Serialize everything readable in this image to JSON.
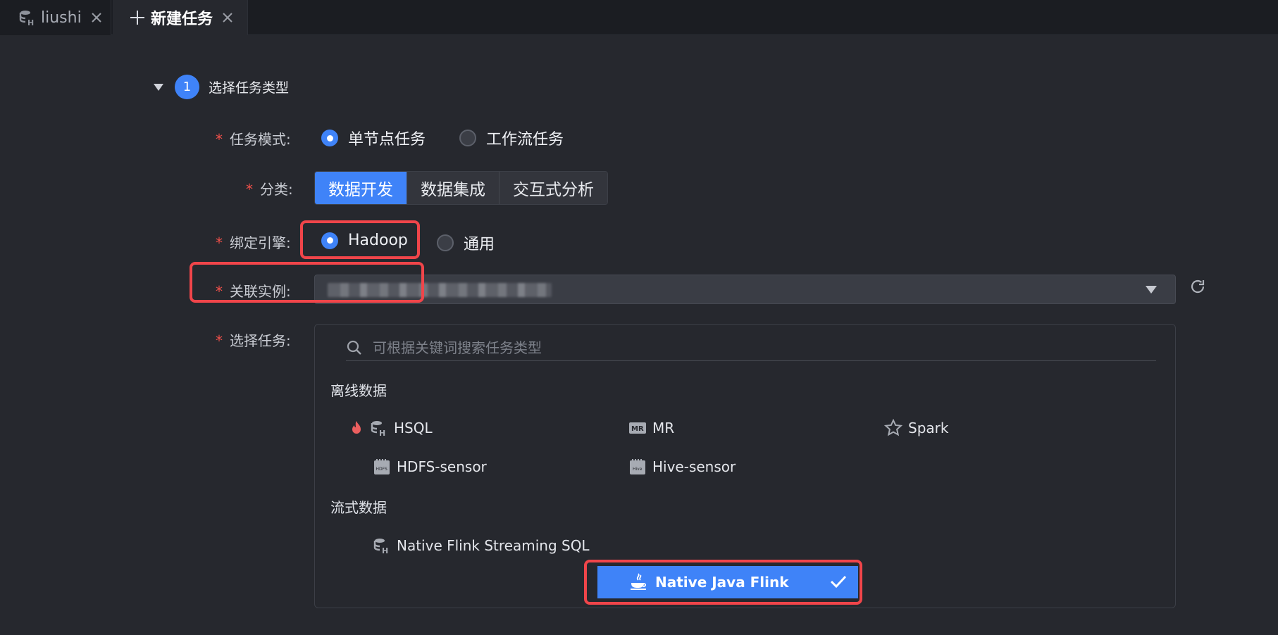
{
  "tabs": [
    {
      "label": "liushi",
      "icon": "database-icon"
    },
    {
      "label": "新建任务",
      "icon": "plus-icon"
    }
  ],
  "section": {
    "step": "1",
    "title": "选择任务类型"
  },
  "form": {
    "mode": {
      "label": "任务模式:",
      "options": [
        "单节点任务",
        "工作流任务"
      ],
      "selected": "单节点任务"
    },
    "category": {
      "label": "分类:",
      "options": [
        "数据开发",
        "数据集成",
        "交互式分析"
      ],
      "selected": "数据开发"
    },
    "engine": {
      "label": "绑定引擎:",
      "options": [
        "Hadoop",
        "通用"
      ],
      "selected": "Hadoop"
    },
    "instance": {
      "label": "关联实例:"
    },
    "task": {
      "label": "选择任务:",
      "search_placeholder": "可根据关键词搜索任务类型",
      "groups": [
        {
          "title": "离线数据",
          "items": [
            {
              "label": "HSQL",
              "icon": "database-icon",
              "hot": true
            },
            {
              "label": "MR",
              "icon": "mr-icon"
            },
            {
              "label": "Spark",
              "icon": "star-icon"
            },
            {
              "label": "HDFS-sensor",
              "icon": "hdfs-sensor-icon"
            },
            {
              "label": "Hive-sensor",
              "icon": "hive-sensor-icon"
            }
          ]
        },
        {
          "title": "流式数据",
          "items": [
            {
              "label": "Native Flink Streaming SQL",
              "icon": "database-icon"
            },
            {
              "label": "Native Java Flink",
              "icon": "java-icon",
              "selected": true
            }
          ]
        }
      ]
    }
  },
  "colors": {
    "accent": "#3f83f8",
    "required": "#f0504a",
    "highlight": "#f0454a",
    "background": "#26282e"
  }
}
